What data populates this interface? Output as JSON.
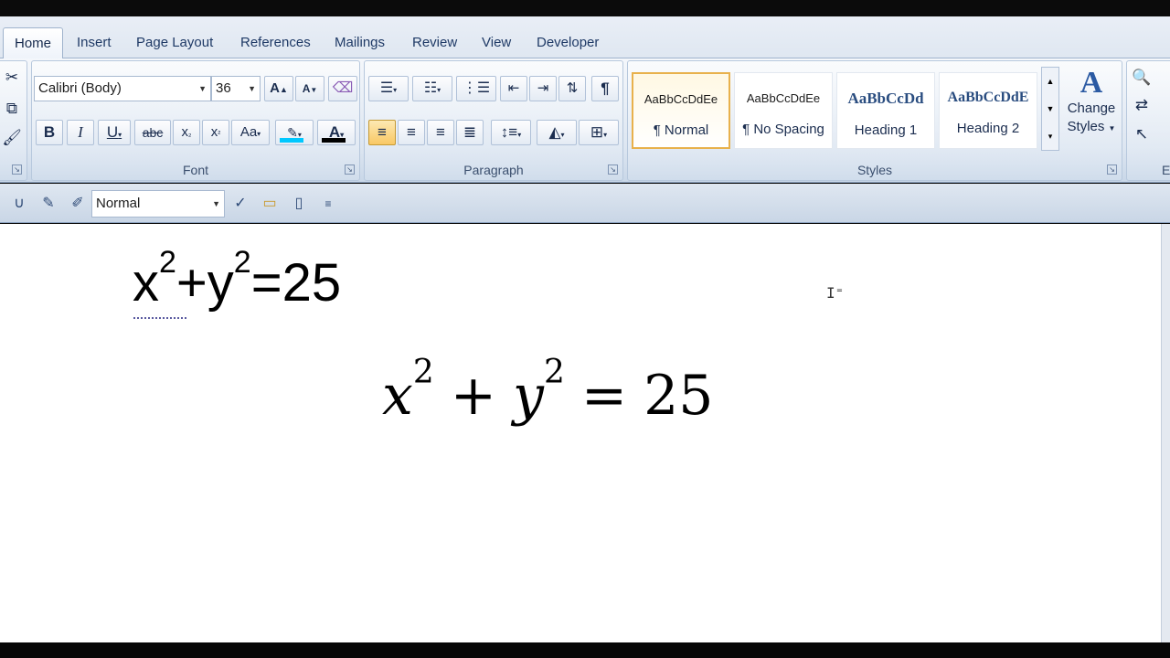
{
  "tabs": [
    "Home",
    "Insert",
    "Page Layout",
    "References",
    "Mailings",
    "Review",
    "View",
    "Developer"
  ],
  "font": {
    "family": "Calibri (Body)",
    "size": "36",
    "group_label": "Font"
  },
  "paragraph": {
    "group_label": "Paragraph"
  },
  "styles": {
    "group_label": "Styles",
    "cards": [
      {
        "preview": "AaBbCcDdEe",
        "name": "¶ Normal"
      },
      {
        "preview": "AaBbCcDdEe",
        "name": "¶ No Spacing"
      },
      {
        "preview": "AaBbCcDd",
        "name": "Heading 1"
      },
      {
        "preview": "AaBbCcDdE",
        "name": "Heading 2"
      }
    ],
    "change_styles_line1": "Change",
    "change_styles_line2": "Styles"
  },
  "editing": {
    "group_label": "Edi"
  },
  "quickbar": {
    "style_value": "Normal"
  },
  "document": {
    "eq1": {
      "base1": "x",
      "exp1": "2",
      "plus": "+",
      "base2": "y",
      "exp2": "2",
      "rest": "=25"
    },
    "eq2": {
      "base1": "x",
      "exp1": "2",
      "plus": "+",
      "base2": "y",
      "exp2": "2",
      "eq": "=",
      "num": "25"
    }
  },
  "colors": {
    "highlight": "#00c8ff",
    "font_color": "#000000",
    "selected_style_border": "#e8b14c"
  }
}
